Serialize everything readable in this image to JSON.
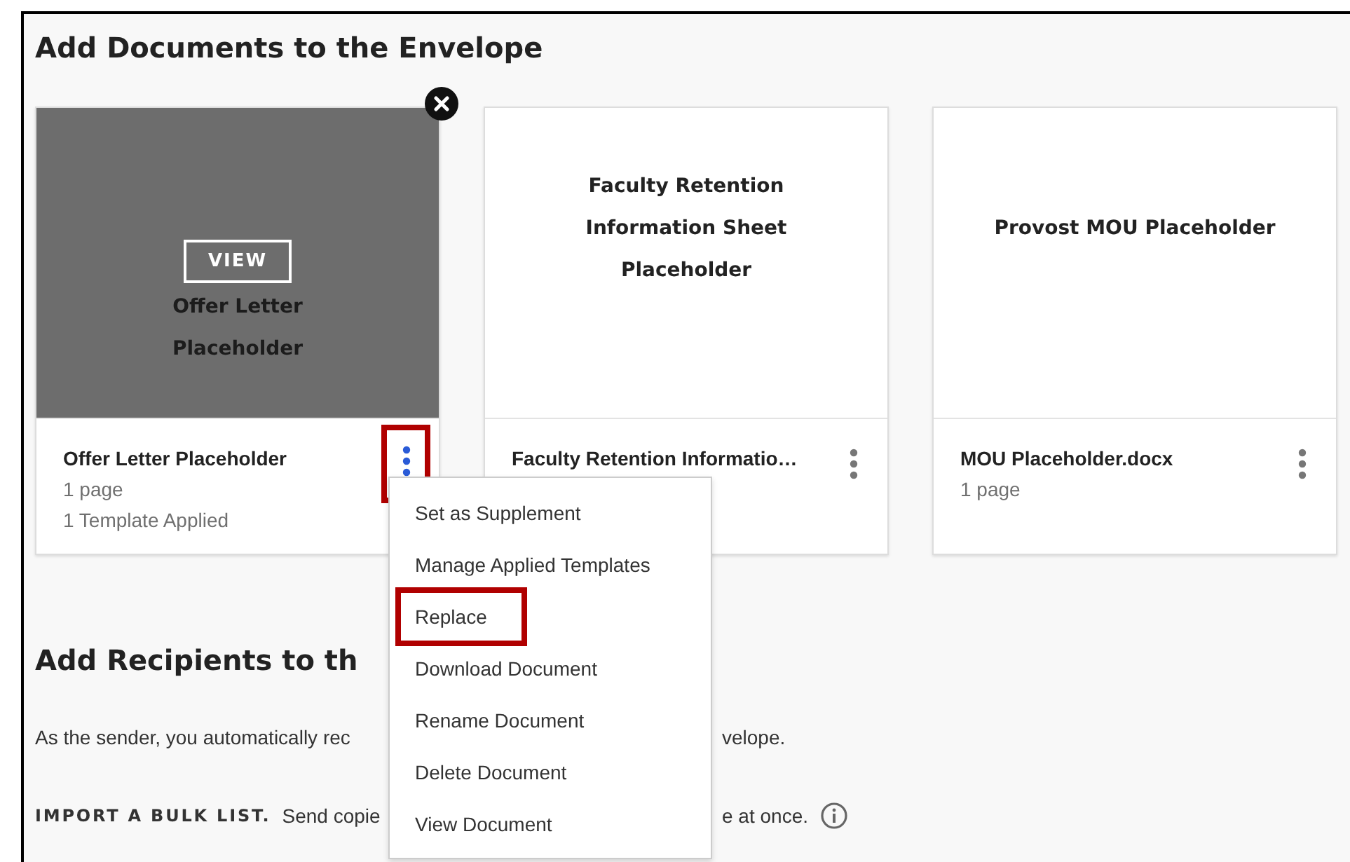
{
  "section_title": "Add Documents to the Envelope",
  "documents": [
    {
      "thumbnail_title": "Offer Letter Placeholder",
      "view_button": "VIEW",
      "hovered": true,
      "removable": true,
      "name": "Offer Letter Placeholder",
      "pages": "1 page",
      "templates": "1 Template Applied",
      "menu_open": true,
      "annotated": true
    },
    {
      "thumbnail_title": "Faculty Retention Information Sheet Placeholder",
      "hovered": false,
      "removable": false,
      "name": "Faculty Retention Informatio…",
      "menu_open": false,
      "annotated": false
    },
    {
      "thumbnail_title": "Provost MOU Placeholder",
      "hovered": false,
      "removable": false,
      "name": "MOU Placeholder.docx",
      "pages": "1 page",
      "menu_open": false,
      "annotated": false
    }
  ],
  "menu": {
    "items": [
      {
        "label": "Set as Supplement",
        "annotated": false
      },
      {
        "label": "Manage Applied Templates",
        "annotated": false
      },
      {
        "label": "Replace",
        "annotated": true
      },
      {
        "label": "Download Document",
        "annotated": false
      },
      {
        "label": "Rename Document",
        "annotated": false
      },
      {
        "label": "Delete Document",
        "annotated": false
      },
      {
        "label": "View Document",
        "annotated": false
      }
    ]
  },
  "recipients": {
    "heading": "Add Recipients to th",
    "sender_note_start": "As the sender, you automatically rec",
    "sender_note_end": "velope.",
    "import_label": "IMPORT A BULK LIST.",
    "import_text_start": "Send copie",
    "import_text_end": "e at once."
  }
}
